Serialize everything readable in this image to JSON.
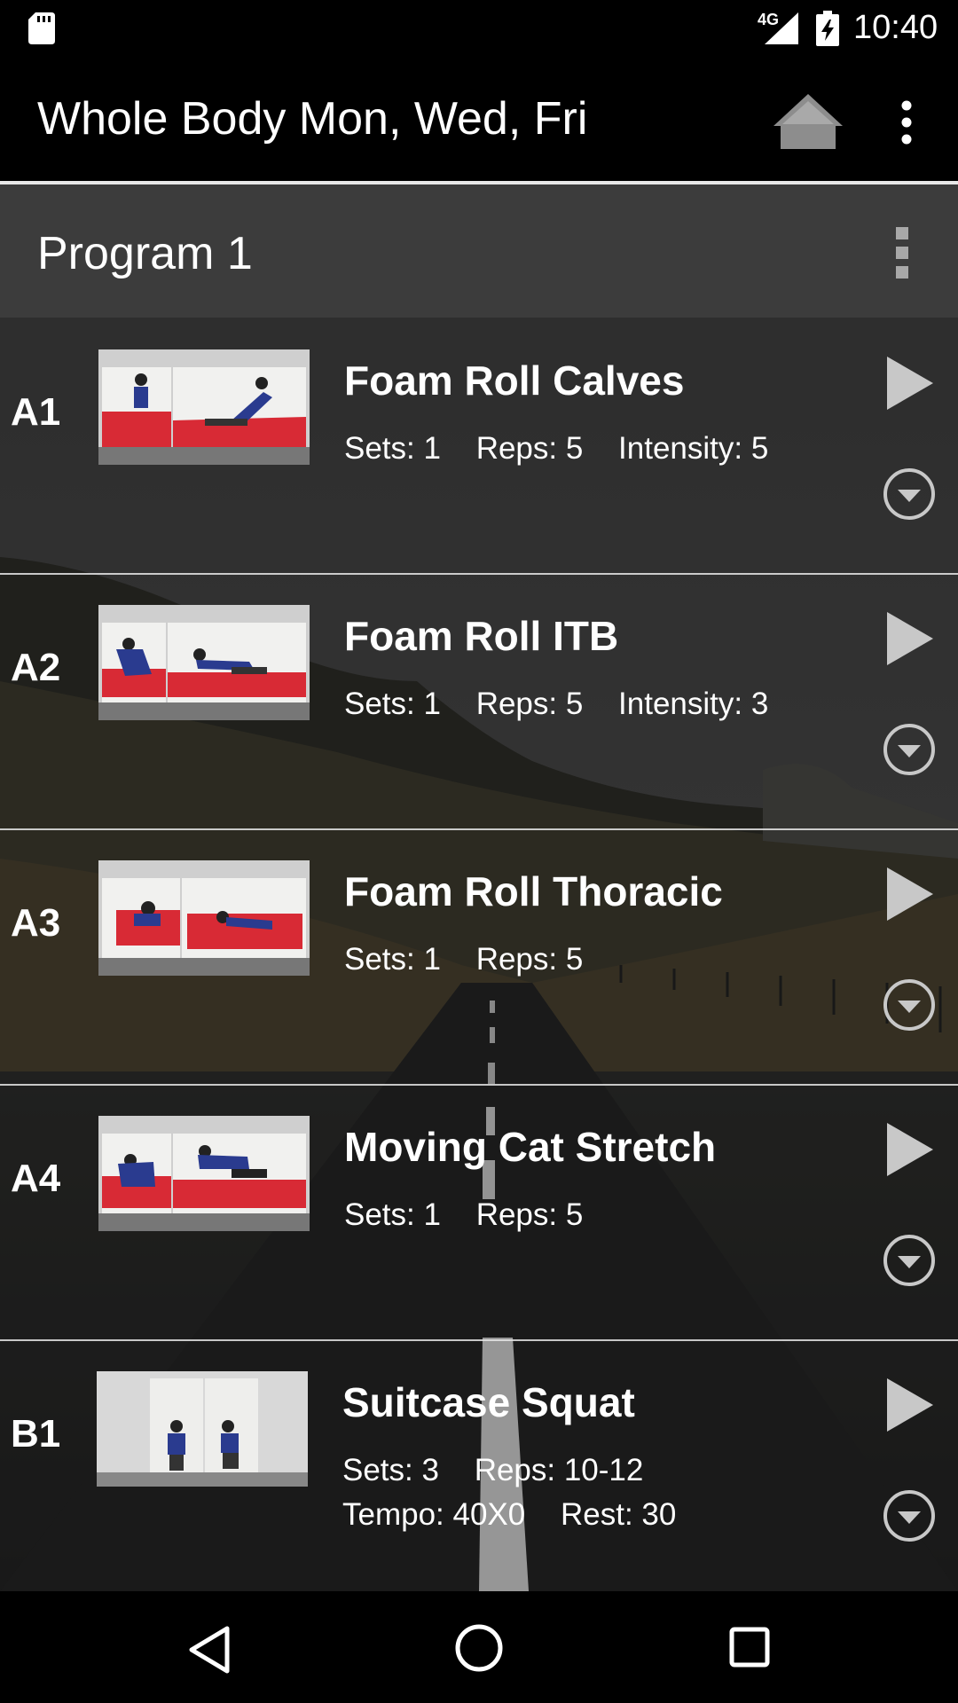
{
  "status_bar": {
    "network": "4G",
    "time": "10:40",
    "icons": [
      "sd-card-icon",
      "signal-icon",
      "battery-charging-icon"
    ]
  },
  "toolbar": {
    "title": "Whole Body Mon, Wed, Fri",
    "icons": [
      "home-icon",
      "overflow-menu-icon"
    ]
  },
  "section": {
    "title": "Program 1",
    "icons": [
      "section-menu-icon"
    ]
  },
  "exercises": [
    {
      "code": "A1",
      "name": "Foam Roll Calves",
      "meta": [
        "Sets: 1",
        "Reps: 5",
        "Intensity: 5"
      ],
      "meta2": []
    },
    {
      "code": "A2",
      "name": "Foam Roll ITB",
      "meta": [
        "Sets: 1",
        "Reps: 5",
        "Intensity: 3"
      ],
      "meta2": []
    },
    {
      "code": "A3",
      "name": "Foam Roll Thoracic",
      "meta": [
        "Sets: 1",
        "Reps: 5"
      ],
      "meta2": []
    },
    {
      "code": "A4",
      "name": "Moving Cat Stretch",
      "meta": [
        "Sets: 1",
        "Reps: 5"
      ],
      "meta2": []
    },
    {
      "code": "B1",
      "name": "Suitcase Squat",
      "meta": [
        "Sets: 3",
        "Reps: 10-12"
      ],
      "meta2": [
        "Tempo: 40X0",
        "Rest: 30"
      ]
    }
  ],
  "nav_bar": {
    "icons": [
      "back-icon",
      "home-circle-icon",
      "recent-apps-icon"
    ]
  },
  "colors": {
    "toolbar_bg": "#000000",
    "section_bg": "#3c3c3c",
    "text": "#ffffff",
    "icon_gray": "#c8c8c8",
    "mat_red": "#d82a35"
  }
}
